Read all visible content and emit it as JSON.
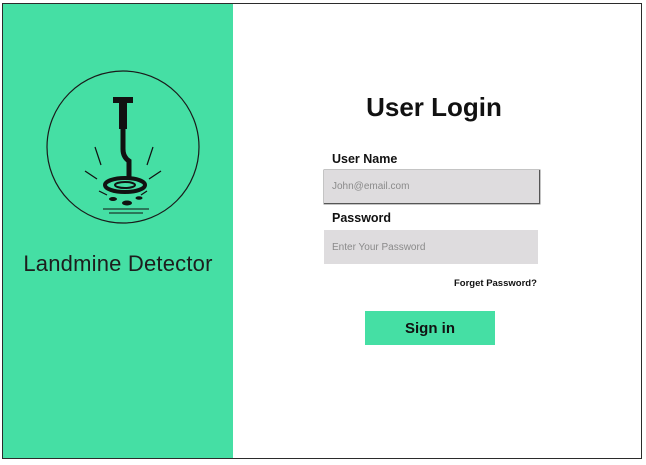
{
  "brand": {
    "app_name": "Landmine Detector",
    "logo_icon": "metal-detector-icon",
    "panel_color": "#45dfa4"
  },
  "login": {
    "title": "User Login",
    "username_label": "User Name",
    "username_placeholder": "John@email.com",
    "password_label": "Password",
    "password_placeholder": "Enter Your Password",
    "forgot_link": "Forget Password?",
    "signin_label": "Sign in",
    "accent_color": "#45dfa4"
  }
}
